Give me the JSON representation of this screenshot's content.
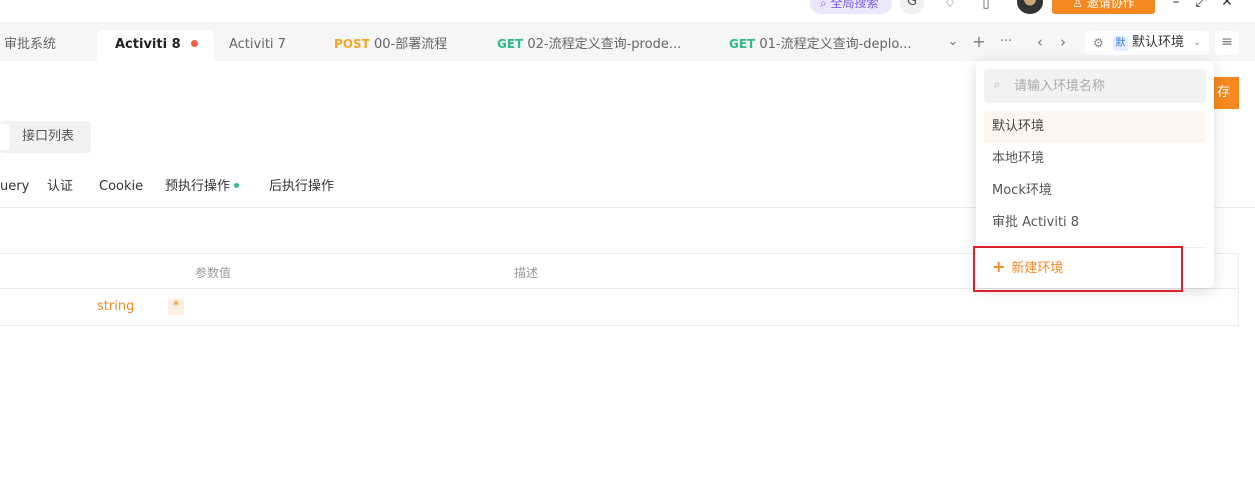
{
  "topbar": {
    "search_label": "全局搜索",
    "g_icon_label": "G",
    "invite_label": "邀请协作"
  },
  "tabs": {
    "items": [
      {
        "label": "审批系统"
      },
      {
        "label": "Activiti 8",
        "unsaved": true
      },
      {
        "label": "Activiti 7"
      },
      {
        "method": "POST",
        "label": "00-部署流程"
      },
      {
        "method": "GET",
        "label": "02-流程定义查询-prode..."
      },
      {
        "method": "GET",
        "label": "01-流程定义查询-deplo..."
      }
    ],
    "controls": {
      "more_down": "⌄",
      "add": "+",
      "ellipsis": "···",
      "prev": "‹",
      "next": "›"
    }
  },
  "env_select": {
    "badge": "默",
    "name": "默认环境"
  },
  "subtabs": {
    "api_list_label": "接口列表"
  },
  "param_tabs": [
    {
      "label": "uery"
    },
    {
      "label": "认证"
    },
    {
      "label": "Cookie"
    },
    {
      "label": "预执行操作",
      "dot": true
    },
    {
      "label": "后执行操作"
    }
  ],
  "table": {
    "headers": {
      "value": "参数值",
      "description": "描述"
    },
    "rows": [
      {
        "type": "string",
        "required_mark": "*"
      }
    ]
  },
  "env_dropdown": {
    "search_placeholder": "请输入环境名称",
    "items": [
      {
        "label": "默认环境",
        "selected": true
      },
      {
        "label": "本地环境"
      },
      {
        "label": "Mock环境"
      },
      {
        "label": "审批 Activiti 8"
      }
    ],
    "new_env_label": "新建环境"
  },
  "colors": {
    "accent": "#f5891f",
    "post": "#f5a623",
    "get": "#2dbd85",
    "highlight": "#d9232e"
  }
}
